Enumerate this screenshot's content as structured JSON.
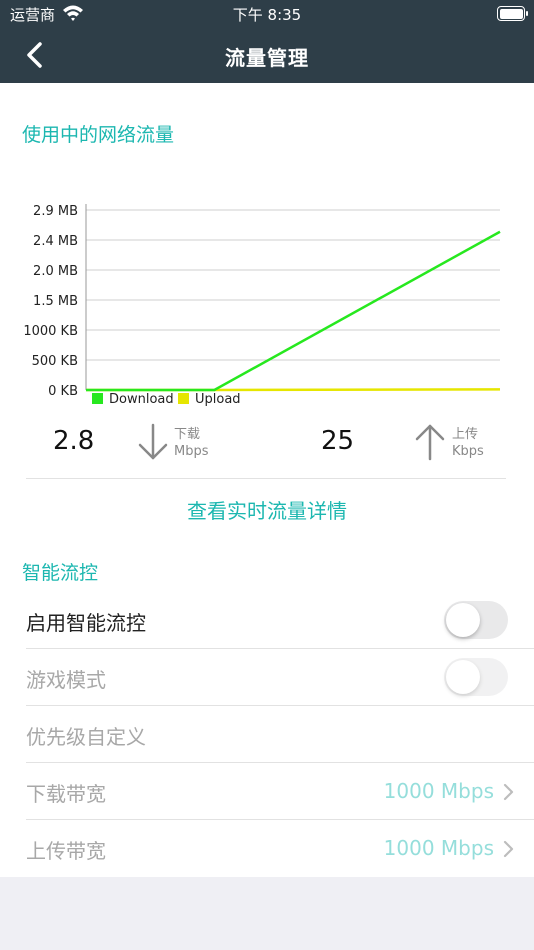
{
  "status_bar": {
    "carrier": "运营商",
    "time": "下午 8:35"
  },
  "nav": {
    "title": "流量管理"
  },
  "usage": {
    "title": "使用中的网络流量"
  },
  "chart_data": {
    "type": "line",
    "y_ticks": [
      "2.9 MB",
      "2.4 MB",
      "2.0 MB",
      "1.5 MB",
      "1000 KB",
      "500 KB",
      "0 KB"
    ],
    "ylim": [
      0,
      2.9
    ],
    "series": [
      {
        "name": "Download",
        "color": "#27e81f",
        "x": [
          0,
          0.31,
          1
        ],
        "values": [
          0,
          0,
          2.55
        ]
      },
      {
        "name": "Upload",
        "color": "#e6e600",
        "x": [
          0,
          0.31,
          1
        ],
        "values": [
          0,
          0,
          0.01
        ]
      }
    ],
    "grid": true,
    "legend": "bottom-left"
  },
  "speeds": {
    "download": {
      "value": "2.8",
      "label": "下载",
      "unit": "Mbps"
    },
    "upload": {
      "value": "25",
      "label": "上传",
      "unit": "Kbps"
    }
  },
  "detail_link": "查看实时流量详情",
  "smart": {
    "title": "智能流控",
    "enable_label": "启用智能流控",
    "game_mode_label": "游戏模式",
    "priority_label": "优先级自定义",
    "download_bw_label": "下载带宽",
    "download_bw_value": "1000 Mbps",
    "upload_bw_label": "上传带宽",
    "upload_bw_value": "1000 Mbps"
  },
  "colors": {
    "nav_bg": "#2e3e48",
    "accent": "#1cb7b0"
  }
}
